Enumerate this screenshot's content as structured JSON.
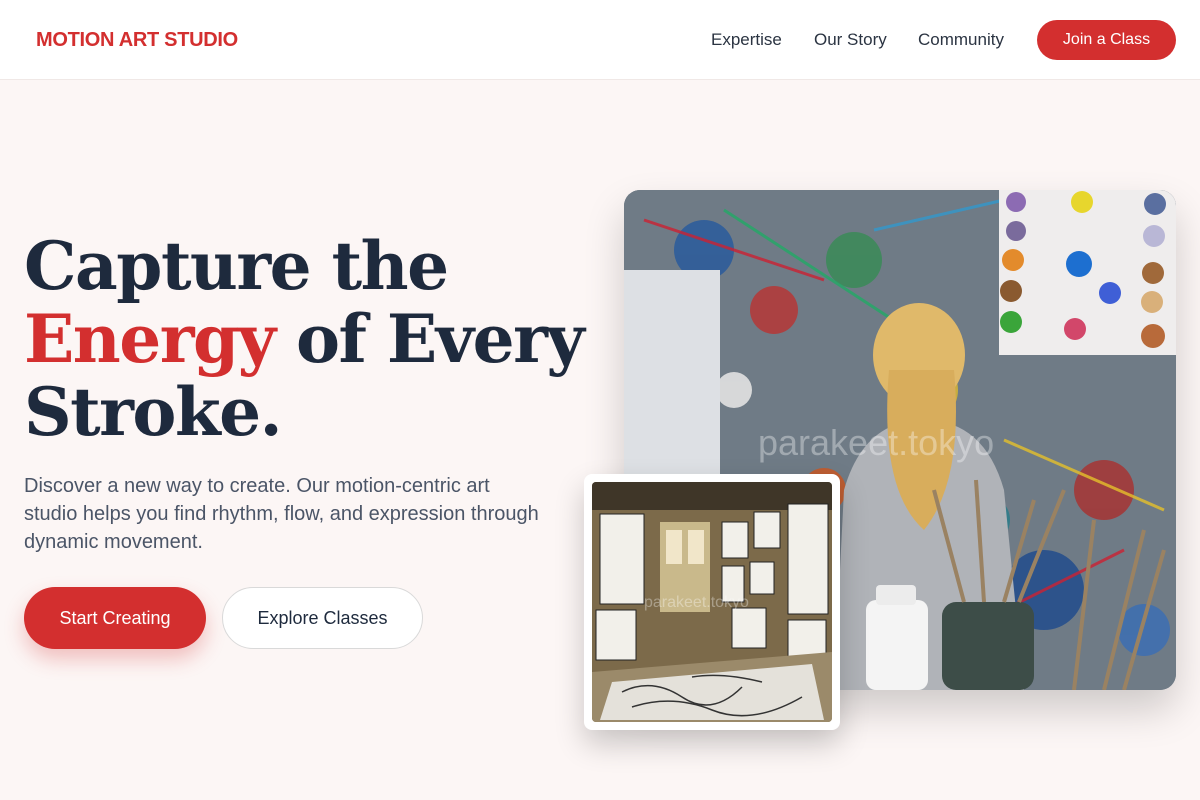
{
  "header": {
    "brand": "MOTION ART STUDIO",
    "nav": [
      "Expertise",
      "Our Story",
      "Community"
    ],
    "cta": "Join a Class"
  },
  "hero": {
    "headline_line1": "Capture the",
    "headline_accent": "Energy",
    "headline_line2_rest": " of Every",
    "headline_line3": "Stroke.",
    "subtitle": "Discover a new way to create. Our motion-centric art studio helps you find rhythm, flow, and expression through dynamic movement.",
    "primary_button": "Start Creating",
    "secondary_button": "Explore Classes"
  },
  "images": {
    "main_watermark": "parakeet.tokyo",
    "inset_watermark": "parakeet.tokyo"
  },
  "colors": {
    "accent": "#d32f2f",
    "heading": "#1e2a3d",
    "background": "#fcf6f5"
  }
}
